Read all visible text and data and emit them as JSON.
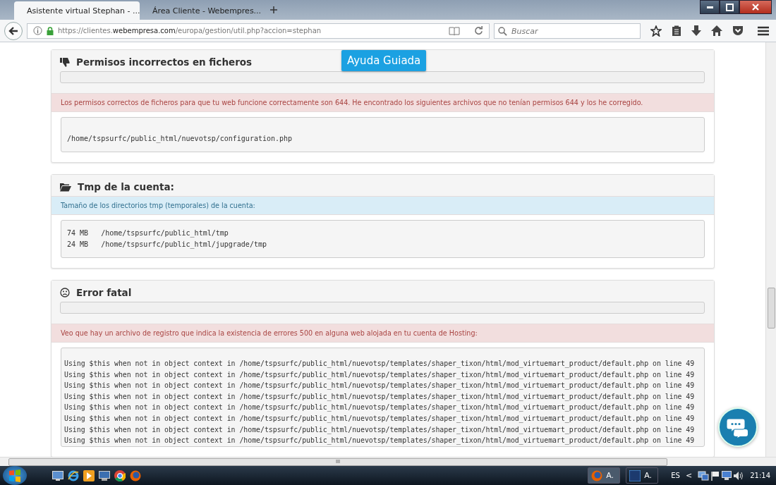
{
  "tabs": [
    {
      "title": "Asistente virtual Stephan - ...",
      "selected": true
    },
    {
      "title": "Área Cliente - Webempres...",
      "selected": false
    }
  ],
  "address": {
    "prefix": "https://clientes.",
    "domain": "webempresa.com",
    "path": "/europa/gestion/util.php?accion=stephan"
  },
  "search": {
    "placeholder": "Buscar"
  },
  "sections": [
    {
      "kind": "thumbs-down",
      "title": "Permisos incorrectos en ficheros",
      "bar": true,
      "alert": {
        "kind": "danger",
        "text": "Los permisos correctos de ficheros para que tu web funcione correctamente son 644. He encontrado los siguientes archivos que no tenían permisos 644 y los he corregido."
      },
      "lines": [
        "/home/tspsurfc/public_html/nuevotsp/configuration.php"
      ]
    },
    {
      "kind": "folder",
      "title": "Tmp de la cuenta:",
      "bar": false,
      "alert": {
        "kind": "info",
        "text": "Tamaño de los directorios tmp (temporales) de la cuenta:"
      },
      "lines": [
        "74 MB   /home/tspsurfc/public_html/tmp",
        "24 MB   /home/tspsurfc/public_html/jupgrade/tmp"
      ]
    },
    {
      "kind": "sad-face",
      "title": "Error fatal",
      "bar": true,
      "alert": {
        "kind": "danger",
        "text": "Veo que hay un archivo de registro que indica la existencia de errores 500 en alguna web alojada en tu cuenta de Hosting:"
      },
      "lines": [
        "Using $this when not in object context in /home/tspsurfc/public_html/nuevotsp/templates/shaper_tixon/html/mod_virtuemart_product/default.php on line 49",
        "Using $this when not in object context in /home/tspsurfc/public_html/nuevotsp/templates/shaper_tixon/html/mod_virtuemart_product/default.php on line 49",
        "Using $this when not in object context in /home/tspsurfc/public_html/nuevotsp/templates/shaper_tixon/html/mod_virtuemart_product/default.php on line 49",
        "Using $this when not in object context in /home/tspsurfc/public_html/nuevotsp/templates/shaper_tixon/html/mod_virtuemart_product/default.php on line 49",
        "Using $this when not in object context in /home/tspsurfc/public_html/nuevotsp/templates/shaper_tixon/html/mod_virtuemart_product/default.php on line 49",
        "Using $this when not in object context in /home/tspsurfc/public_html/nuevotsp/templates/shaper_tixon/html/mod_virtuemart_product/default.php on line 49",
        "Using $this when not in object context in /home/tspsurfc/public_html/nuevotsp/templates/shaper_tixon/html/mod_virtuemart_product/default.php on line 49",
        "Using $this when not in object context in /home/tspsurfc/public_html/nuevotsp/templates/shaper_tixon/html/mod_virtuemart_product/default.php on line 49"
      ]
    }
  ],
  "guide_button": "Ayuda Guiada",
  "hscroll_grip": "III",
  "taskbar": {
    "windows": [
      {
        "label": "A.",
        "kind": "firefox",
        "selected": true
      },
      {
        "label": "A.",
        "kind": "photoshop",
        "selected": false
      }
    ],
    "language": "ES",
    "tray_arrow": "<",
    "clock": "21:14"
  }
}
